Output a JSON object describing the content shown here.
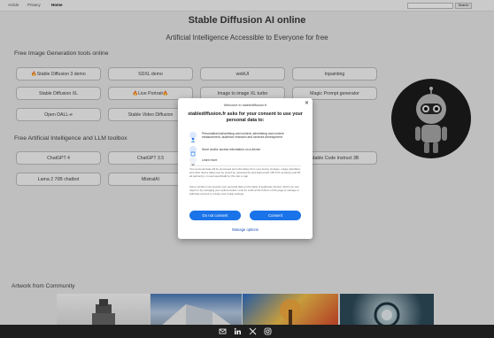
{
  "nav": {
    "items": [
      {
        "label": "Article"
      },
      {
        "label": "Privacy"
      },
      {
        "label": "Home"
      }
    ],
    "search_button": "Search"
  },
  "hero": {
    "title": "Stable Diffusion AI online",
    "subtitle": "Artificial Intelligence Accessible to Everyone for free"
  },
  "image_section": {
    "title": "Free Image Generation tools online",
    "tools": [
      {
        "label": "🔥Stable Diffusion 3 demo"
      },
      {
        "label": "SDXL demo"
      },
      {
        "label": "webUI"
      },
      {
        "label": "Inpainting"
      },
      {
        "label": "Stable Diffusion XL"
      },
      {
        "label": "🔥Live Portrait🔥"
      },
      {
        "label": "Image to image XL turbo"
      },
      {
        "label": "Magic Prompt generator"
      },
      {
        "label": "Open DALL-e"
      },
      {
        "label": "Stable Video Diffusion"
      }
    ]
  },
  "llm_section": {
    "title": "Free Artificial Intelligence and LLM toolbox",
    "tools": [
      {
        "label": "ChatGPT 4"
      },
      {
        "label": "ChatGPT 3.5"
      },
      {
        "label": "Stable Code Instruct 3B"
      },
      {
        "label": "Lama 2 70B chatbot"
      },
      {
        "label": "MistralAI"
      }
    ]
  },
  "community": {
    "title": "Artwork from Community"
  },
  "footer": {
    "icons": [
      "email-icon",
      "linkedin-icon",
      "x-icon",
      "instagram-icon"
    ]
  },
  "consent": {
    "welcome": "Welcome to stablediffusion.fr",
    "heading": "stablediffusion.fr asks for your consent to use your personal data to:",
    "purposes": [
      {
        "icon": "person-icon",
        "text": "Personalised advertising and content, advertising and content measurement, audience research and services development"
      },
      {
        "icon": "device-icon",
        "text": "Store and/or access information on a device"
      }
    ],
    "learn_more": "Learn more",
    "body_1": "Your personal data will be processed and information from your device (cookies, unique identifiers, and other device data) may be stored by, accessed by and shared with 135 TCF vendor(s) and 65 ad partner(s), or used specifically by this site or app.",
    "body_2": "Some vendors may process your personal data on the basis of legitimate interest, which you can object to by managing your options below. Look for a link at the bottom of this page to manage or withdraw consent in privacy and cookie settings.",
    "do_not_consent": "Do not consent",
    "consent_button": "Consent",
    "manage_options": "Manage options"
  },
  "colors": {
    "accent": "#1a73e8",
    "footer_bg": "#1e1e1e"
  }
}
